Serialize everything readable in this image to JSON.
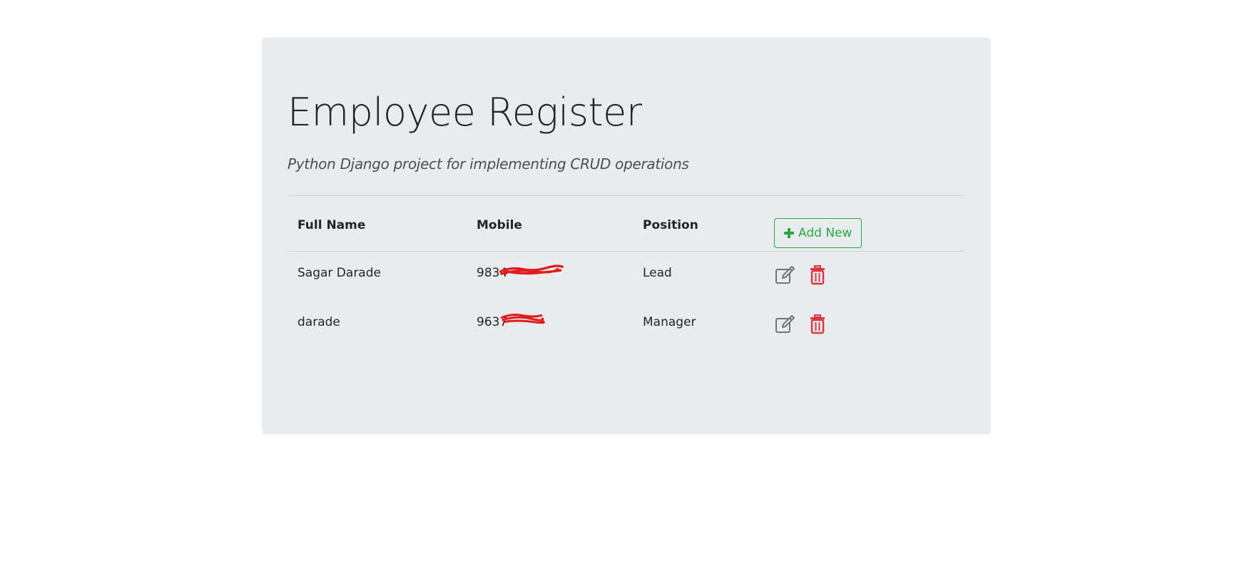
{
  "header": {
    "title": "Employee Register",
    "subtitle": "Python Django project for implementing CRUD operations"
  },
  "table": {
    "columns": [
      "Full Name",
      "Mobile",
      "Position"
    ],
    "add_button_label": "Add New",
    "rows": [
      {
        "full_name": "Sagar Darade",
        "mobile": "9834",
        "position": "Lead"
      },
      {
        "full_name": "darade",
        "mobile": "9637",
        "position": "Manager"
      }
    ]
  },
  "colors": {
    "accent_success": "#28a745",
    "danger": "#dc3545",
    "edit_icon": "#6c757d",
    "redaction": "#e31b1b"
  },
  "icons": {
    "add": "plus-icon",
    "edit": "edit-icon",
    "delete": "trash-icon"
  }
}
